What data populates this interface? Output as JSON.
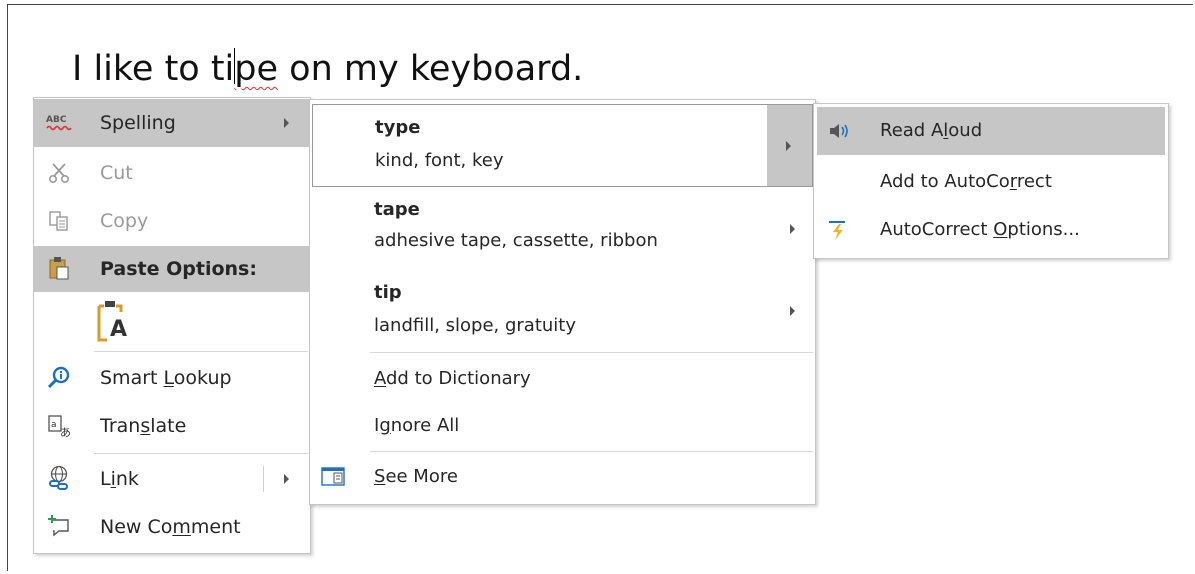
{
  "document": {
    "text_before_caret": "I like to ti",
    "misspelled_after_caret": "pe",
    "text_after": " on my keyboard."
  },
  "context_menu": {
    "spelling": "Spelling",
    "cut": "Cut",
    "copy": "Copy",
    "paste_options": "Paste Options:",
    "paste_keep_text_glyph": "A",
    "smart_lookup": "Smart Lookup",
    "translate": "Translate",
    "link": "Link",
    "new_comment": "New Comment",
    "spelling_badge": "ABC"
  },
  "spelling_menu": {
    "suggestions": [
      {
        "word": "type",
        "synonyms": "kind, font, key"
      },
      {
        "word": "tape",
        "synonyms": "adhesive tape, cassette, ribbon"
      },
      {
        "word": "tip",
        "synonyms": "landfill, slope, gratuity"
      }
    ],
    "add_to_dictionary": "Add to Dictionary",
    "ignore_all": "Ignore All",
    "see_more": "See More"
  },
  "suggestion_submenu": {
    "read_aloud": "Read Aloud",
    "add_to_autocorrect": "Add to AutoCorrect",
    "autocorrect_options": "AutoCorrect Options..."
  },
  "colors": {
    "highlight": "#c6c6c6",
    "squiggle": "#e0302a",
    "icon_blue": "#1f6fbf",
    "icon_orange": "#d89b2a"
  }
}
